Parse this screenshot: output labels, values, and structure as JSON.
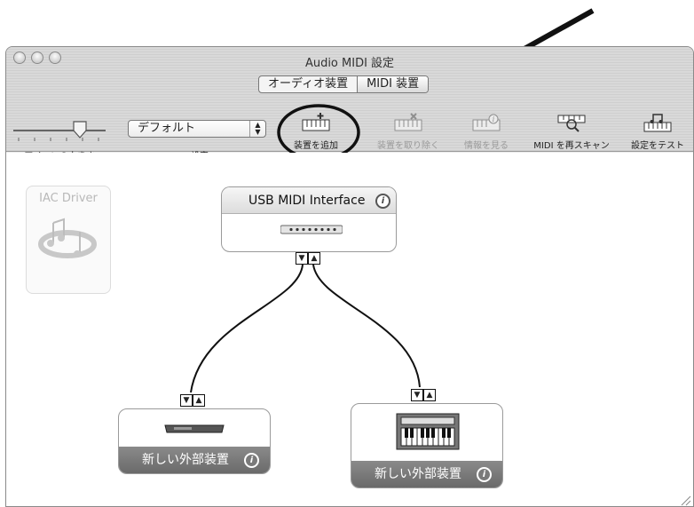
{
  "window": {
    "title": "Audio MIDI 設定",
    "tabs": [
      {
        "label": "オーディオ装置",
        "selected": false
      },
      {
        "label": "MIDI 装置",
        "selected": true
      }
    ]
  },
  "toolbar": {
    "icon_size_label": "アイコンの大きさ",
    "config_popup_value": "デフォルト",
    "config_label": "設定",
    "add_device_label": "装置を追加",
    "remove_device_label": "装置を取り除く",
    "show_info_label": "情報を見る",
    "rescan_label": "MIDI を再スキャン",
    "test_setup_label": "設定をテスト"
  },
  "devices": {
    "iac_driver": {
      "name": "IAC Driver"
    },
    "usb_interface": {
      "name": "USB MIDI Interface"
    },
    "external_1": {
      "name": "新しい外部装置"
    },
    "external_2": {
      "name": "新しい外部装置"
    }
  },
  "ports": {
    "down": "▼",
    "up": "▲"
  },
  "icons": {
    "info": "i"
  },
  "colors": {
    "footer_bar": "#7a7a7a",
    "window_bg": "#ececec"
  }
}
